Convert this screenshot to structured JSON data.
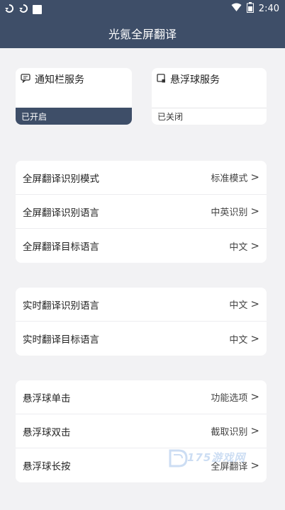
{
  "status_bar": {
    "time": "2:40",
    "icons": [
      "sync-icon",
      "sync-icon",
      "square-icon",
      "wifi-icon",
      "battery-icon"
    ]
  },
  "app_bar": {
    "title": "光氪全屏翻译"
  },
  "services": {
    "notification": {
      "label": "通知栏服务",
      "status": "已开启",
      "icon": "chat-icon",
      "active": true
    },
    "floating": {
      "label": "悬浮球服务",
      "status": "已关闭",
      "icon": "square-icon",
      "active": false
    }
  },
  "groups": [
    {
      "rows": [
        {
          "label": "全屏翻译识别模式",
          "value": "标准模式"
        },
        {
          "label": "全屏翻译识别语言",
          "value": "中英识别"
        },
        {
          "label": "全屏翻译目标语言",
          "value": "中文"
        }
      ]
    },
    {
      "rows": [
        {
          "label": "实时翻译识别语言",
          "value": "中文"
        },
        {
          "label": "实时翻译目标语言",
          "value": "中文"
        }
      ]
    },
    {
      "rows": [
        {
          "label": "悬浮球单击",
          "value": "功能选项"
        },
        {
          "label": "悬浮球双击",
          "value": "截取识别"
        },
        {
          "label": "悬浮球长按",
          "value": "全屏翻译"
        }
      ]
    }
  ],
  "chevron": ">",
  "watermark": {
    "text": "175游戏网"
  },
  "colors": {
    "primary": "#3e4e68",
    "background": "#f2f2f4",
    "card": "#ffffff"
  }
}
